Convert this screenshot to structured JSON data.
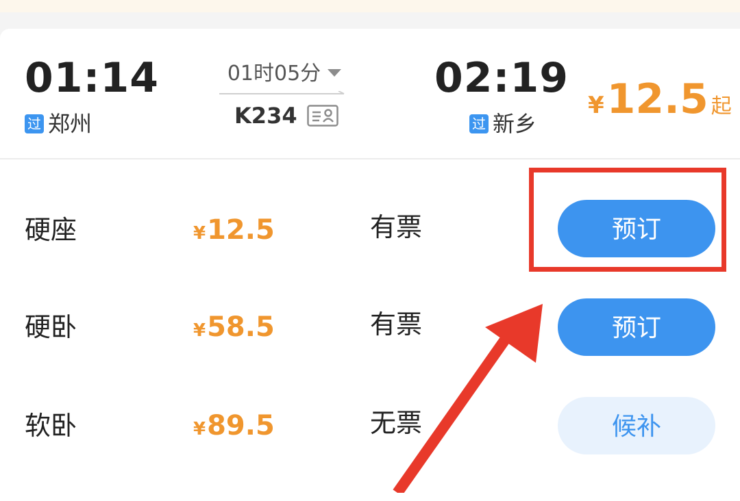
{
  "train": {
    "departure_time": "01:14",
    "departure_station": "郑州",
    "departure_badge": "过",
    "arrival_time": "02:19",
    "arrival_station": "新乡",
    "arrival_badge": "过",
    "duration": "01时05分",
    "train_number": "K234",
    "start_price": {
      "currency": "¥",
      "amount": "12.5",
      "suffix": "起"
    }
  },
  "seats": [
    {
      "name": "硬座",
      "currency": "¥",
      "price": "12.5",
      "status": "有票",
      "action": "预订",
      "action_type": "book"
    },
    {
      "name": "硬卧",
      "currency": "¥",
      "price": "58.5",
      "status": "有票",
      "action": "预订",
      "action_type": "book"
    },
    {
      "name": "软卧",
      "currency": "¥",
      "price": "89.5",
      "status": "无票",
      "action": "候补",
      "action_type": "waitlist"
    }
  ],
  "icons": {
    "caret": "caret-down-icon",
    "id_card": "id-card-icon",
    "arrow": "arrow-annotation-icon"
  },
  "colors": {
    "primary_blue": "#3d94ef",
    "price_orange": "#f0962e",
    "annotation_red": "#e8392a",
    "waitlist_bg": "#e8f2fd"
  }
}
